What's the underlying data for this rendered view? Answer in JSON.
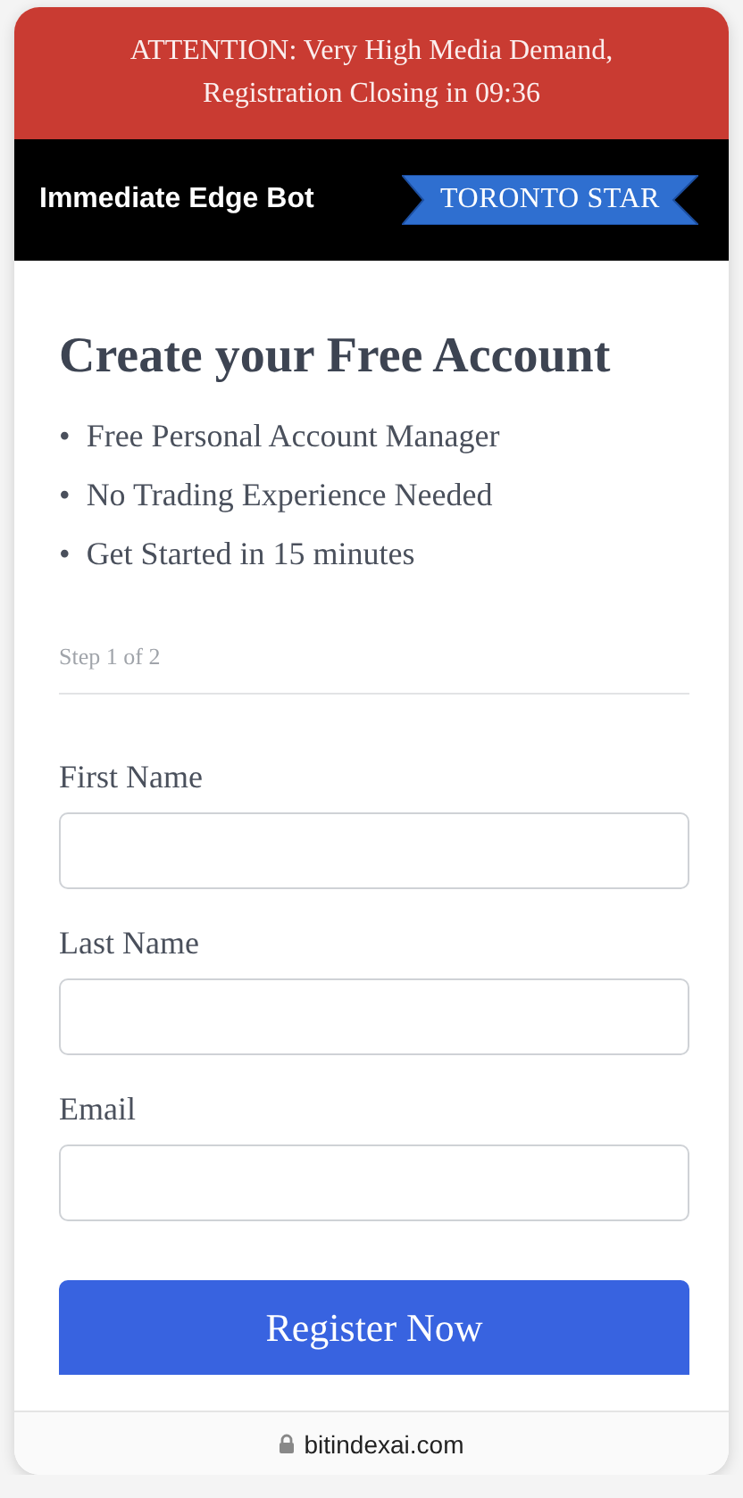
{
  "banner": {
    "line_1": "ATTENTION: Very High Media Demand,",
    "line_2": "Registration Closing in 09:36"
  },
  "header": {
    "brand": "Immediate Edge Bot",
    "press_badge": "TORONTO STAR"
  },
  "form": {
    "title": "Create your Free Account",
    "benefits": [
      {
        "bullet": "•",
        "text": "Free Personal Account Manager"
      },
      {
        "bullet": "•",
        "text": "No Trading Experience Needed"
      },
      {
        "bullet": "•",
        "text": "Get Started in 15 minutes"
      }
    ],
    "step": "Step 1 of 2",
    "fields": [
      {
        "label": "First Name"
      },
      {
        "label": "Last Name"
      },
      {
        "label": "Email"
      }
    ],
    "submit": "Register Now"
  },
  "address_bar": {
    "url": "bitindexai.com"
  }
}
